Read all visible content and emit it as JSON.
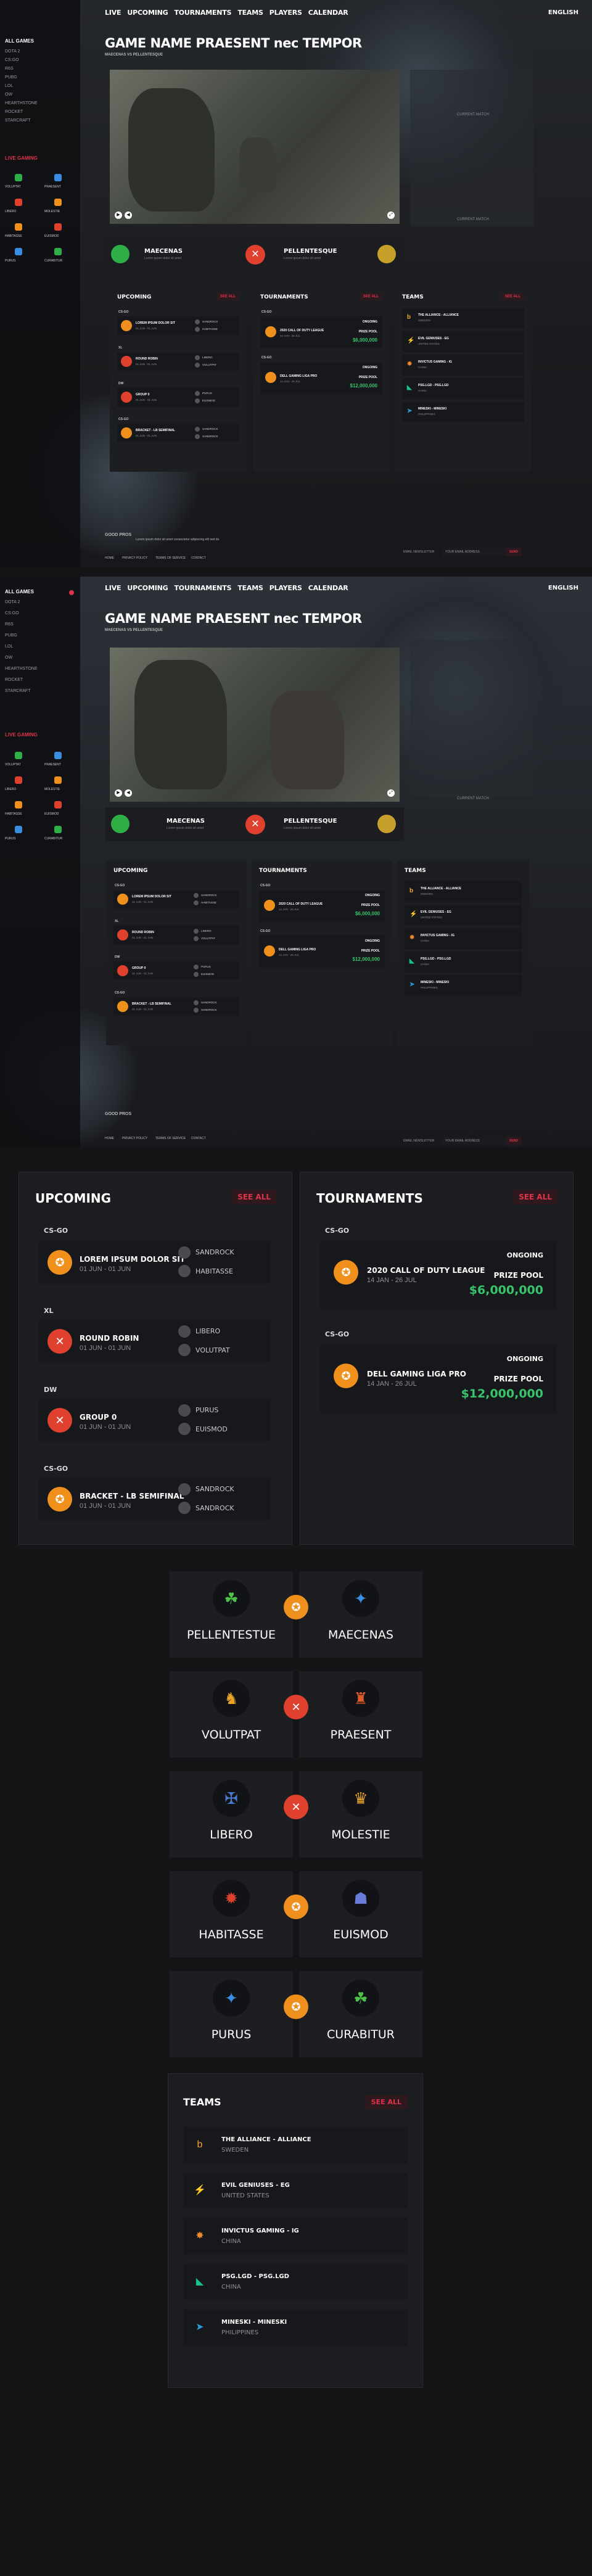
{
  "nav": {
    "live": "LIVE",
    "upcoming": "UPCOMING",
    "tournaments": "TOURNAMENTS",
    "teams": "TEAMS",
    "players": "PLAYERS",
    "calendar": "CALENDAR",
    "lang": "ENGLISH"
  },
  "sidebar": {
    "title": "ALL GAMES",
    "items": [
      "DOTA 2",
      "CS:GO",
      "R6S",
      "PUBG",
      "LOL",
      "OW",
      "HEARTHSTONE",
      "ROCKET",
      "STARCRAFT"
    ],
    "live_title": "LIVE GAMING",
    "live": [
      {
        "a": "VOLUPTAT",
        "b": "PRAESENT"
      },
      {
        "a": "LIBERO",
        "b": "MOLESTIE"
      },
      {
        "a": "HABITASSE",
        "b": "EUISMOD"
      },
      {
        "a": "PURUS",
        "b": "CURABITUR"
      }
    ]
  },
  "hero": {
    "title": "GAME NAME PRAESENT nec TEMPOR",
    "subtitle": "MAECENAS VS PELLENTESQUE"
  },
  "side_label": "CURRENT MATCH",
  "match": {
    "team_a": "MAECENAS",
    "team_b": "PELLENTESQUE",
    "sub": "Lorem ipsum dolor sit amet"
  },
  "upcoming": {
    "title": "UPCOMING",
    "see_all": "SEE ALL",
    "groups": [
      {
        "cat": "CS-GO",
        "name": "LOREM IPSUM DOLOR SIT",
        "date": "01 JUN - 01 JUN",
        "teams": [
          "SANDROCK",
          "HABITASSE"
        ],
        "game": "csgo"
      },
      {
        "cat": "XL",
        "name": "ROUND ROBIN",
        "date": "01 JUN - 01 JUN",
        "teams": [
          "LIBERO",
          "VOLUTPAT"
        ],
        "game": "dota"
      },
      {
        "cat": "DW",
        "name": "GROUP 0",
        "date": "01 JUN - 01 JUN",
        "teams": [
          "PURUS",
          "EUISMOD"
        ],
        "game": "dota"
      },
      {
        "cat": "CS-GO",
        "name": "BRACKET - LB SEMIFINAL",
        "date": "01 JUN - 01 JUN",
        "teams": [
          "SANDROCK",
          "SANDROCK"
        ],
        "game": "csgo"
      }
    ]
  },
  "tournaments": {
    "title": "TOURNAMENTS",
    "see_all": "SEE ALL",
    "items": [
      {
        "cat": "CS-GO",
        "name": "2020 CALL OF DUTY LEAGUE",
        "date": "14 JAN - 26 JUL",
        "status": "ONGOING",
        "pool_label": "PRIZE POOL",
        "pool": "$6,000,000"
      },
      {
        "cat": "CS-GO",
        "name": "DELL GAMING LIGA PRO",
        "date": "14 JAN - 26 JUL",
        "status": "ONGOING",
        "pool_label": "PRIZE POOL",
        "pool": "$12,000,000"
      }
    ]
  },
  "teams": {
    "title": "TEAMS",
    "see_all": "SEE ALL",
    "items": [
      {
        "name": "THE ALLIANCE - ALLIANCE",
        "country": "SWEDEN",
        "color": "#f0a531",
        "icon": "b"
      },
      {
        "name": "EVIL GENIUSES - EG",
        "country": "UNITED STATES",
        "color": "#2fae48",
        "icon": "⚡"
      },
      {
        "name": "INVICTUS GAMING - IG",
        "country": "CHINA",
        "color": "#f28a2c",
        "icon": "✸"
      },
      {
        "name": "PSG.LGD - PSG.LGD",
        "country": "CHINA",
        "color": "#19c28b",
        "icon": "◣"
      },
      {
        "name": "MINESKI - MINESKI",
        "country": "PHILIPPINES",
        "color": "#2a9ed8",
        "icon": "➤"
      }
    ]
  },
  "versus": [
    {
      "a": "PELLENTESTUE",
      "b": "MAECENAS",
      "game": "csgo"
    },
    {
      "a": "VOLUTPAT",
      "b": "PRAESENT",
      "game": "dota"
    },
    {
      "a": "LIBERO",
      "b": "MOLESTIE",
      "game": "dota"
    },
    {
      "a": "HABITASSE",
      "b": "EUISMOD",
      "game": "csgo"
    },
    {
      "a": "PURUS",
      "b": "CURABITUR",
      "game": "csgo"
    }
  ],
  "footer": {
    "logo": "GOOD PROS",
    "desc": "Lorem ipsum dolor sit amet consectetur adipiscing elit sed do",
    "links": [
      "HOME",
      "PRIVACY POLICY",
      "TERMS OF SERVICE",
      "CONTACT"
    ],
    "newsletter": "EMAIL NEWSLETTER",
    "placeholder": "YOUR EMAIL ADDRESS",
    "send": "SEND"
  },
  "colors": {
    "accent": "#e0334b",
    "green": "#37c46a",
    "csgo": "#f0901c",
    "dota": "#e0402e"
  }
}
